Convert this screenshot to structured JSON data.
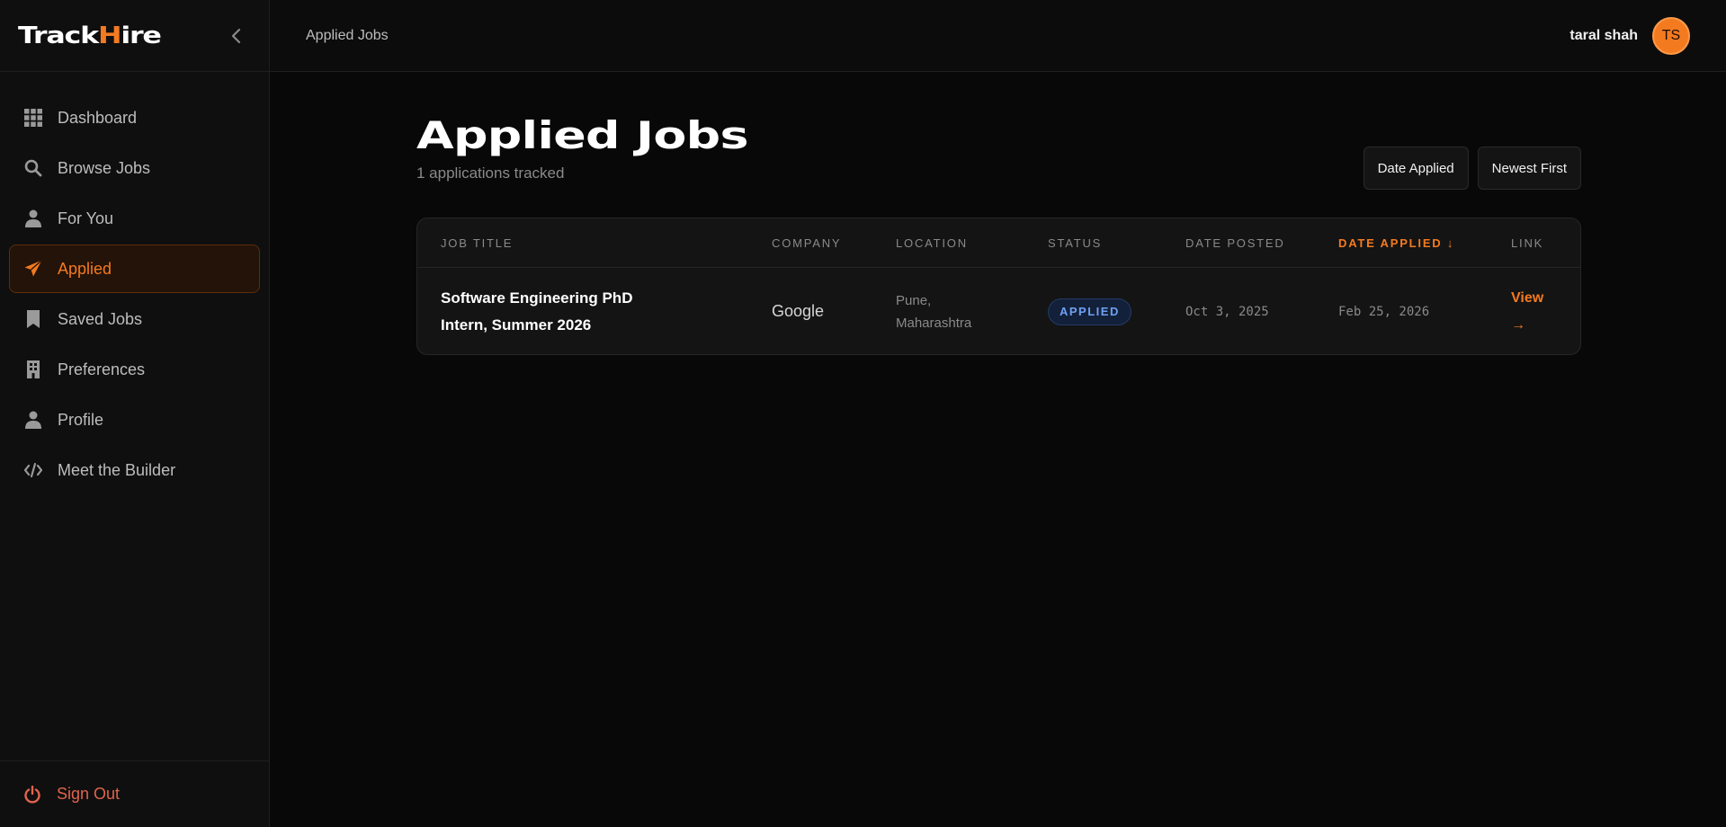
{
  "brand": {
    "part1": "Track",
    "accent": "H",
    "part2": "ire",
    "accent_color": "#f47a20"
  },
  "sidebar": {
    "items": [
      {
        "label": "Dashboard",
        "icon": "grid-icon"
      },
      {
        "label": "Browse Jobs",
        "icon": "search-icon"
      },
      {
        "label": "For You",
        "icon": "person-icon"
      },
      {
        "label": "Applied",
        "icon": "send-icon",
        "active": true
      },
      {
        "label": "Saved Jobs",
        "icon": "bookmark-icon"
      },
      {
        "label": "Preferences",
        "icon": "building-icon"
      },
      {
        "label": "Profile",
        "icon": "person-icon"
      },
      {
        "label": "Meet the Builder",
        "icon": "code-icon"
      }
    ],
    "signout_label": "Sign Out"
  },
  "topbar": {
    "breadcrumb": "Applied Jobs",
    "user_name": "taral shah",
    "avatar_initials": "TS"
  },
  "main": {
    "title": "Applied Jobs",
    "subtitle": "1 applications tracked",
    "sort_field": "Date Applied",
    "sort_order": "Newest First"
  },
  "table": {
    "columns": [
      "JOB TITLE",
      "COMPANY",
      "LOCATION",
      "STATUS",
      "DATE POSTED",
      "DATE APPLIED ↓",
      "LINK"
    ],
    "rows": [
      {
        "title": "Software Engineering PhD Intern, Summer 2026",
        "company": "Google",
        "location": "Pune, Maharashtra",
        "status": "APPLIED",
        "date_posted": "Oct 3, 2025",
        "date_applied": "Feb 25, 2026",
        "link": "View →"
      }
    ]
  },
  "colors": {
    "accent": "#f47a20",
    "status_applied": "#6ea1f2",
    "signout": "#e0644c"
  }
}
